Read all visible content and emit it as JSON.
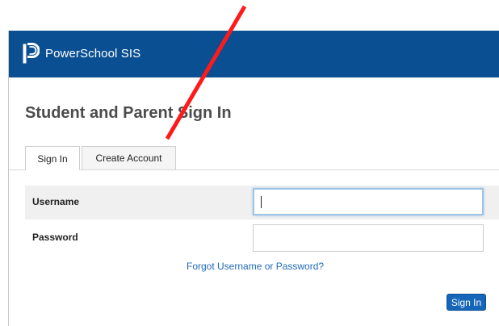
{
  "app": {
    "brand": "PowerSchool SIS",
    "accent_color": "#0a4f92",
    "logo_icon": "powerschool-logo-icon"
  },
  "page": {
    "title": "Student and Parent Sign In"
  },
  "tabs": [
    {
      "label": "Sign In",
      "active": true
    },
    {
      "label": "Create Account",
      "active": false
    }
  ],
  "form": {
    "username": {
      "label": "Username",
      "value": "",
      "placeholder": "",
      "focused": true
    },
    "password": {
      "label": "Password",
      "value": "",
      "placeholder": ""
    },
    "forgot_link": "Forgot Username or Password?",
    "submit_label": "Sign In"
  },
  "annotation": {
    "type": "arrow",
    "color": "#ff1a1a",
    "points_to": "Create Account tab"
  }
}
